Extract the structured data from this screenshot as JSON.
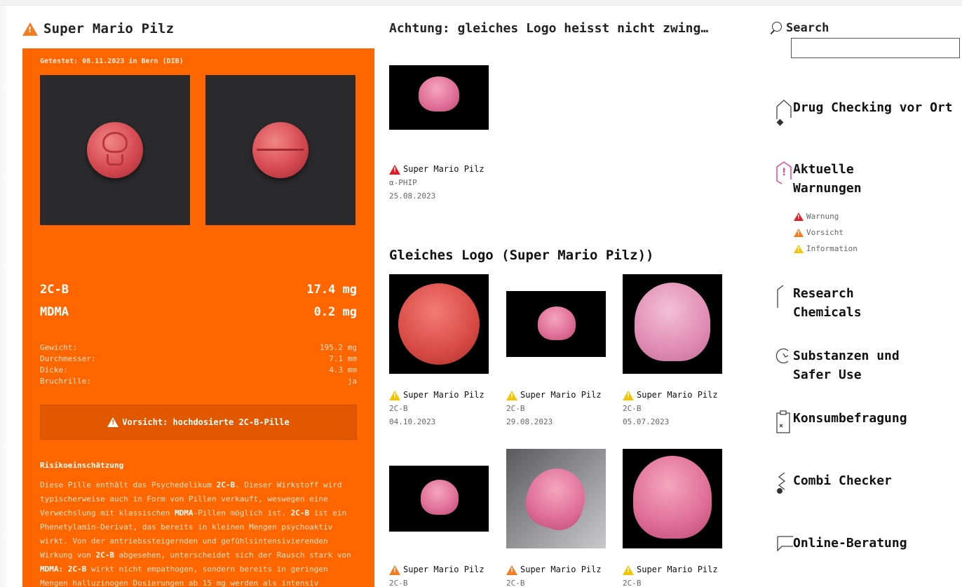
{
  "left": {
    "title": "Super Mario Pilz",
    "tested": "Getestet: 08.11.2023 in Bern (DIB)",
    "substances": [
      {
        "name": "2C-B",
        "amount": "17.4 mg"
      },
      {
        "name": "MDMA",
        "amount": "0.2 mg"
      }
    ],
    "stats": [
      {
        "label": "Gewicht:",
        "value": "195.2 mg"
      },
      {
        "label": "Durchmesser:",
        "value": "7.1 mm"
      },
      {
        "label": "Dicke:",
        "value": "4.3 mm"
      },
      {
        "label": "Bruchrille:",
        "value": "ja"
      }
    ],
    "warning": "Vorsicht: hochdosierte 2C-B-Pille",
    "risk_heading": "Risikoeinschätzung",
    "risk_parts": [
      "Diese Pille enthält das Psychedelikum ",
      "2C-B",
      ". Dieser Wirkstoff wird typischerweise auch in Form von Pillen verkauft, weswegen eine Verwechslung mit klassischen ",
      "MDMA",
      "-Pillen möglich ist. ",
      "2C-B",
      " ist ein Phenetylamin-Derivat, das bereits in kleinen Mengen psychoaktiv wirkt. Von der antriebssteigernden und gefühlsintensivierenden Wirkung von ",
      "2C-B",
      " abgesehen, unterscheidet sich der Rausch stark von ",
      "MDMA: 2C-B",
      " wirkt nicht empathogen, sondern bereits in geringen Mengen halluzinogen Dosierungen ab 15 mg werden als intensiv"
    ]
  },
  "middle": {
    "heading_notice": "Achtung: gleiches Logo heisst nicht zwing…",
    "notice_item": {
      "name": "Super Mario Pilz",
      "substance": "α-PHIP",
      "date": "25.08.2023",
      "level": "red"
    },
    "heading_same": "Gleiches Logo (Super Mario Pilz))",
    "grid": [
      {
        "name": "Super Mario Pilz",
        "substance": "2C-B",
        "date": "04.10.2023",
        "level": "yellow"
      },
      {
        "name": "Super Mario Pilz",
        "substance": "2C-B",
        "date": "29.08.2023",
        "level": "yellow"
      },
      {
        "name": "Super Mario Pilz",
        "substance": "2C-B",
        "date": "05.07.2023",
        "level": "yellow"
      },
      {
        "name": "Super Mario Pilz",
        "substance": "2C-B",
        "date": "",
        "level": "orange"
      },
      {
        "name": "Super Mario Pilz",
        "substance": "2C-B",
        "date": "",
        "level": "orange"
      },
      {
        "name": "Super Mario Pilz",
        "substance": "2C-B",
        "date": "",
        "level": "yellow"
      }
    ]
  },
  "right": {
    "search_label": "Search",
    "search_placeholder": "",
    "nav": [
      {
        "label": "Drug Checking vor Ort",
        "icon": "test-tube-icon"
      },
      {
        "label": "Aktuelle\nWarnungen",
        "icon": "warning-hex-icon"
      },
      {
        "label": "Research\nChemicals",
        "icon": "flask-icon"
      },
      {
        "label": "Substanzen und\nSafer Use",
        "icon": "leaf-icon"
      },
      {
        "label": "Konsumbefragung",
        "icon": "clipboard-icon"
      },
      {
        "label": "Combi Checker",
        "icon": "pills-icon"
      },
      {
        "label": "Online-Beratung",
        "icon": "chat-icon"
      }
    ],
    "legend": [
      {
        "label": "Warnung",
        "color": "#e31e24"
      },
      {
        "label": "Vorsicht",
        "color": "#f47b20"
      },
      {
        "label": "Information",
        "color": "#f5c400"
      }
    ]
  },
  "colors": {
    "accent": "#ff6600",
    "warning_red": "#e31e24",
    "warning_orange": "#f47b20",
    "warning_yellow": "#f5c400"
  }
}
